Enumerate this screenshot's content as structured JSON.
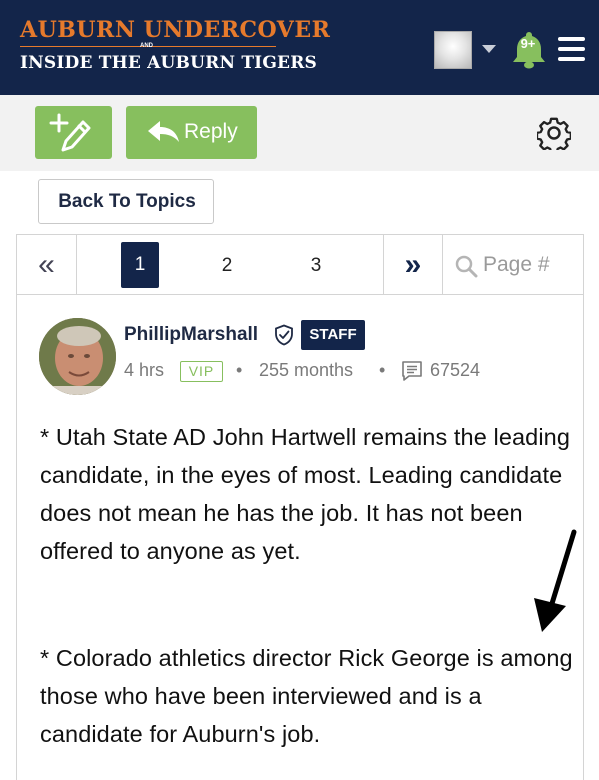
{
  "header": {
    "logo_top": "AUBURN UNDERCOVER",
    "logo_and": "AND",
    "logo_bottom": "INSIDE THE AUBURN TIGERS",
    "notification_count": "9+",
    "icons": [
      "user-avatar",
      "chevron-down-icon",
      "bell-icon",
      "menu-icon"
    ]
  },
  "toolbar": {
    "reply_label": "Reply",
    "icons": [
      "new-topic-icon",
      "reply-icon",
      "gear-icon"
    ]
  },
  "nav": {
    "back_label": "Back To Topics"
  },
  "pagination": {
    "current": "1",
    "pages": [
      "1",
      "2",
      "3"
    ],
    "first_symbol": "«",
    "last_symbol": "»",
    "page_placeholder": "Page #"
  },
  "post": {
    "author": "PhillipMarshall",
    "badge": "STAFF",
    "time": "4 hrs",
    "tier": "VIP",
    "tenure": "255 months",
    "post_count": "67524",
    "separator": "•",
    "paragraphs": [
      "* Utah State AD John Hartwell remains the leading candidate, in the eyes of most. Leading candidate does not mean he has the job. It has not been offered to anyone as yet.",
      "* Colorado athletics director Rick George is among those who have been interviewed and is a candidate for Auburn's job."
    ]
  },
  "colors": {
    "navy": "#13254a",
    "orange": "#e67a2c",
    "green": "#87bf5e"
  }
}
